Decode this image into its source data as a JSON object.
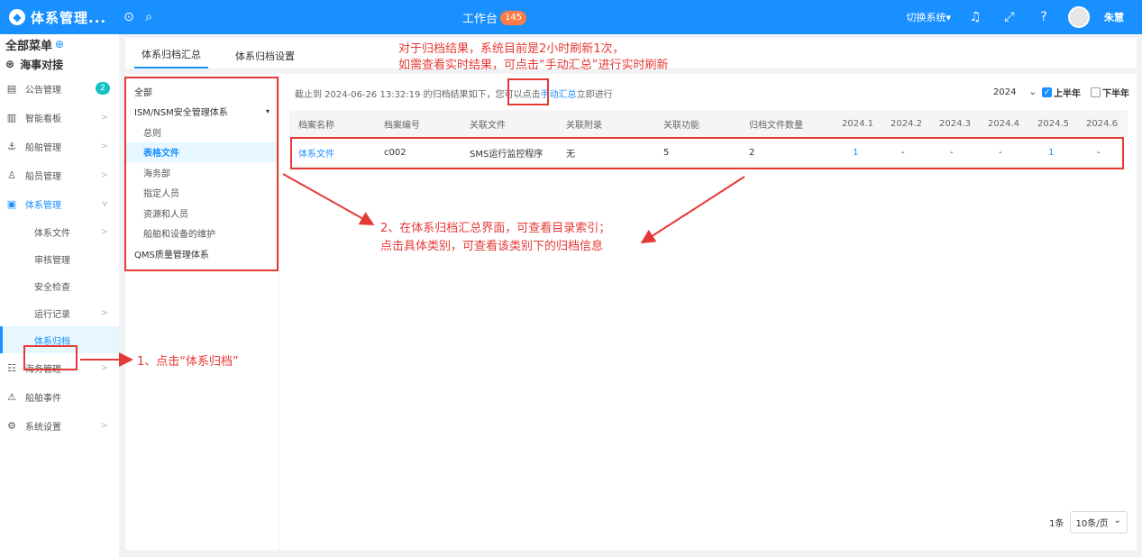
{
  "header": {
    "logo_text": "体系管理...",
    "logo_glyph": "◆",
    "collapse_icon": "⊙",
    "search_icon": "⌕",
    "center_title": "工作台",
    "center_badge": "145",
    "switch_system": "切换系统▾",
    "bell_icon": "♫",
    "fullscreen_icon": "⤢",
    "help_icon": "?",
    "username": "朱慧"
  },
  "sidebar": {
    "all_menu": "全部菜单",
    "plus_icon": "⊕",
    "section_title": "海事对接",
    "section_icon": "⊛",
    "items": [
      {
        "label": "公告管理",
        "icon": "▤",
        "badge": "2"
      },
      {
        "label": "智能看板",
        "icon": "▥",
        "arrow": ">"
      },
      {
        "label": "船舶管理",
        "icon": "⚓",
        "arrow": ">"
      },
      {
        "label": "船员管理",
        "icon": "♙",
        "arrow": ">"
      },
      {
        "label": "体系管理",
        "icon": "▣",
        "arrow": "∨"
      }
    ],
    "sub_items": [
      {
        "label": "体系文件",
        "arrow": ">"
      },
      {
        "label": "审核管理"
      },
      {
        "label": "安全检查"
      },
      {
        "label": "运行记录",
        "arrow": ">"
      },
      {
        "label": "体系归档"
      }
    ],
    "bottom_items": [
      {
        "label": "海务管理",
        "icon": "☷",
        "arrow": ">"
      },
      {
        "label": "船舶事件",
        "icon": "⚠"
      },
      {
        "label": "系统设置",
        "icon": "⚙",
        "arrow": ">"
      }
    ]
  },
  "tabs": [
    "体系归档汇总",
    "体系归档设置"
  ],
  "tree": {
    "items": [
      "全部",
      "ISM/NSM安全管理体系",
      "总则",
      "表格文件",
      "海务部",
      "指定人员",
      "资源和人员",
      "船舶和设备的维护",
      "QMS质量管理体系"
    ],
    "caret": "▾"
  },
  "info": {
    "prefix": "截止到 2024-06-26 13:32:19 的归档结果如下，您可以点击",
    "link": "手动汇总",
    "suffix": "立即进行"
  },
  "filters": {
    "year": "2024",
    "year_arrow": "⌄",
    "first_half": "上半年",
    "second_half": "下半年",
    "check_mark": "✓"
  },
  "table": {
    "headers": [
      "档案名称",
      "档案编号",
      "关联文件",
      "关联附录",
      "关联功能",
      "归档文件数量",
      "2024.1",
      "2024.2",
      "2024.3",
      "2024.4",
      "2024.5",
      "2024.6"
    ],
    "rows": [
      [
        "体系文件",
        "c002",
        "SMS运行监控程序",
        "无",
        "5",
        "2",
        "1",
        "-",
        "-",
        "-",
        "1",
        "-"
      ]
    ]
  },
  "pager": {
    "total": "1条",
    "page_size": "10条/页",
    "arrow": "⌄"
  },
  "annotations": {
    "top_line1": "对于归档结果，系统目前是2小时刷新1次，",
    "top_line2": "如需查看实时结果，可点击“手动汇总”进行实时刷新",
    "mid_line1": "2、在体系归档汇总界面，可查看目录索引；",
    "mid_line2": "点击具体类别，可查看该类别下的归档信息",
    "left": "1、点击“体系归档”"
  },
  "colors": {
    "primary": "#1890ff",
    "annotation": "#e53935",
    "badge_orange": "#ff7a45",
    "badge_green": "#13c2c2"
  }
}
